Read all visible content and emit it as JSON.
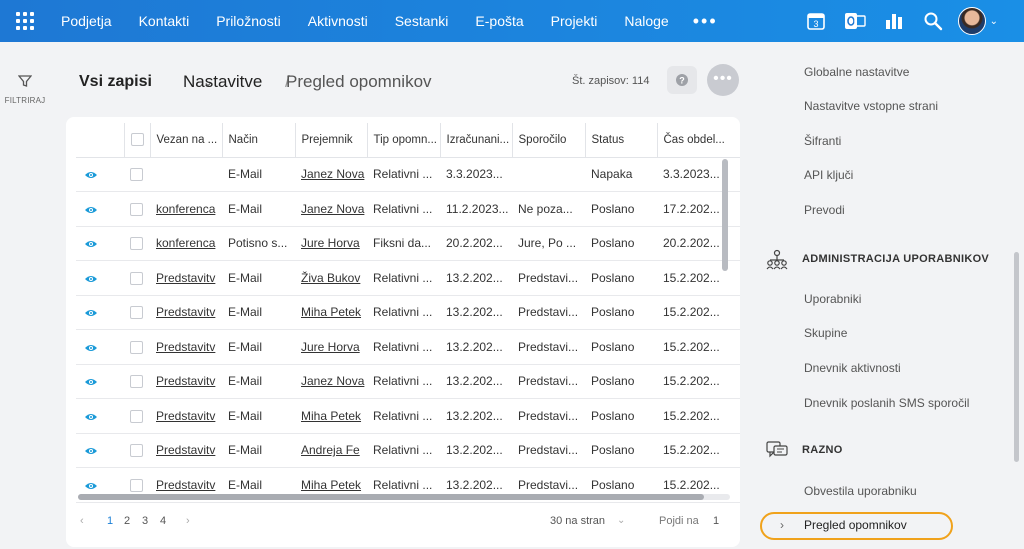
{
  "topbar": {
    "nav": [
      "Podjetja",
      "Kontakti",
      "Priložnosti",
      "Aktivnosti",
      "Sestanki",
      "E-pošta",
      "Projekti",
      "Naloge"
    ],
    "more": "•••",
    "calendar_day": "3"
  },
  "filter": {
    "label": "FILTRIRAJ"
  },
  "header": {
    "view_selector": "Vsi zapisi",
    "breadcrumb": [
      "Nastavitve",
      "/",
      "Pregled opomnikov"
    ],
    "record_count": "Št. zapisov: 114",
    "help": "?",
    "more": "•••"
  },
  "table": {
    "columns": [
      "Vezan na ...",
      "Način",
      "Prejemnik",
      "Tip opomn...",
      "Izračunani...",
      "Sporočilo",
      "Status",
      "Čas obdel..."
    ],
    "rows": [
      [
        "",
        "E-Mail",
        "Janez Nova",
        "Relativni ...",
        "3.3.2023...",
        "",
        "Napaka",
        "3.3.2023..."
      ],
      [
        "konferenca",
        "E-Mail",
        "Janez Nova",
        "Relativni ...",
        "11.2.2023...",
        "Ne poza...",
        "Poslano",
        "17.2.202..."
      ],
      [
        "konferenca",
        "Potisno s...",
        "Jure Horva",
        "Fiksni da...",
        "20.2.202...",
        "Jure, Po ...",
        "Poslano",
        "20.2.202..."
      ],
      [
        "Predstavitv",
        "E-Mail",
        "Živa Bukov",
        "Relativni ...",
        "13.2.202...",
        "Predstavi...",
        "Poslano",
        "15.2.202..."
      ],
      [
        "Predstavitv",
        "E-Mail",
        "Miha Petek",
        "Relativni ...",
        "13.2.202...",
        "Predstavi...",
        "Poslano",
        "15.2.202..."
      ],
      [
        "Predstavitv",
        "E-Mail",
        "Jure Horva",
        "Relativni ...",
        "13.2.202...",
        "Predstavi...",
        "Poslano",
        "15.2.202..."
      ],
      [
        "Predstavitv",
        "E-Mail",
        "Janez Nova",
        "Relativni ...",
        "13.2.202...",
        "Predstavi...",
        "Poslano",
        "15.2.202..."
      ],
      [
        "Predstavitv",
        "E-Mail",
        "Miha Petek",
        "Relativni ...",
        "13.2.202...",
        "Predstavi...",
        "Poslano",
        "15.2.202..."
      ],
      [
        "Predstavitv",
        "E-Mail",
        "Andreja Fe",
        "Relativni ...",
        "13.2.202...",
        "Predstavi...",
        "Poslano",
        "15.2.202..."
      ],
      [
        "Predstavitv",
        "E-Mail",
        "Miha Petek",
        "Relativni ...",
        "13.2.202...",
        "Predstavi...",
        "Poslano",
        "15.2.202..."
      ]
    ]
  },
  "pagination": {
    "prev": "‹",
    "pages": [
      "1",
      "2",
      "3",
      "4"
    ],
    "next": "›",
    "per_page": "30 na stran",
    "goto_label": "Pojdi na",
    "goto_value": "1"
  },
  "settings_panel": {
    "items_top": [
      "Globalne nastavitve",
      "Nastavitve vstopne strani",
      "Šifranti",
      "API ključi",
      "Prevodi"
    ],
    "section_users": "ADMINISTRACIJA UPORABNIKOV",
    "items_users": [
      "Uporabniki",
      "Skupine",
      "Dnevnik aktivnosti",
      "Dnevnik poslanih SMS sporočil"
    ],
    "section_misc": "RAZNO",
    "items_misc": [
      "Obvestila uporabniku"
    ],
    "active_caret": "›",
    "active_item": "Pregled opomnikov"
  },
  "colors": {
    "topbar": "#1e78d4",
    "accent_link": "#1a7fd6",
    "highlight_outline": "#f0a21b"
  },
  "icons": [
    "apps-grid-icon",
    "calendar-icon",
    "outlook-icon",
    "bar-chart-icon",
    "search-icon",
    "filter-icon",
    "eye-icon",
    "users-admin-icon",
    "chat-icon"
  ]
}
